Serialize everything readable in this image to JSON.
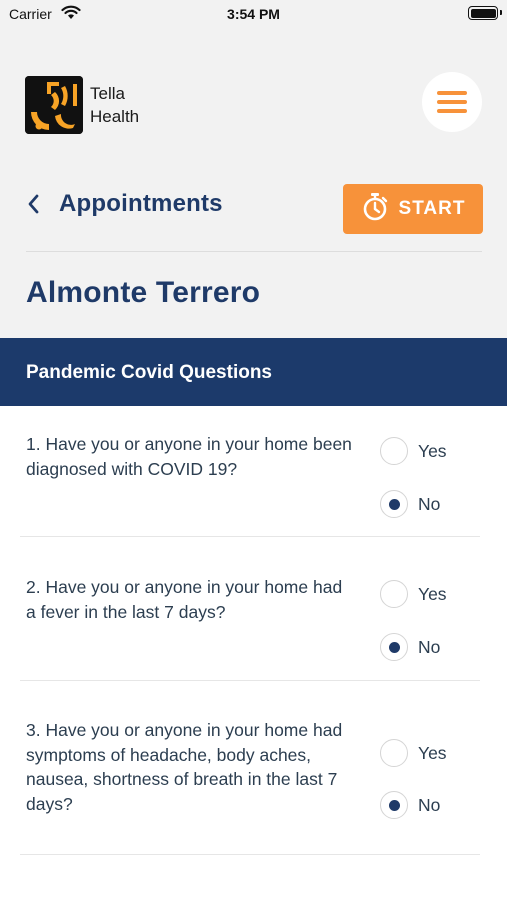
{
  "status_bar": {
    "carrier": "Carrier",
    "time": "3:54 PM",
    "icons": [
      "wifi-icon",
      "battery-icon"
    ]
  },
  "header": {
    "logo_line1": "Tella",
    "logo_line2": "Health",
    "menu_icon": "hamburger-icon",
    "back_label": "Appointments",
    "start_label": "START",
    "start_icon": "stopwatch-icon",
    "patient_name": "Almonte Terrero"
  },
  "section": {
    "title": "Pandemic Covid Questions"
  },
  "questions": [
    {
      "text": "1. Have you or anyone in your home been diagnosed with COVID 19?",
      "options": [
        "Yes",
        "No"
      ],
      "selected": "No"
    },
    {
      "text": "2. Have you or anyone in your home had a fever in the last 7 days?",
      "options": [
        "Yes",
        "No"
      ],
      "selected": "No"
    },
    {
      "text": "3. Have you or anyone in your home had symptoms of headache, body aches, nausea, shortness of breath in the last 7 days?",
      "options": [
        "Yes",
        "No"
      ],
      "selected": "No"
    }
  ],
  "colors": {
    "accent": "#f7923a",
    "navy": "#1c3a6b",
    "header_bg": "#f2f2f2"
  }
}
